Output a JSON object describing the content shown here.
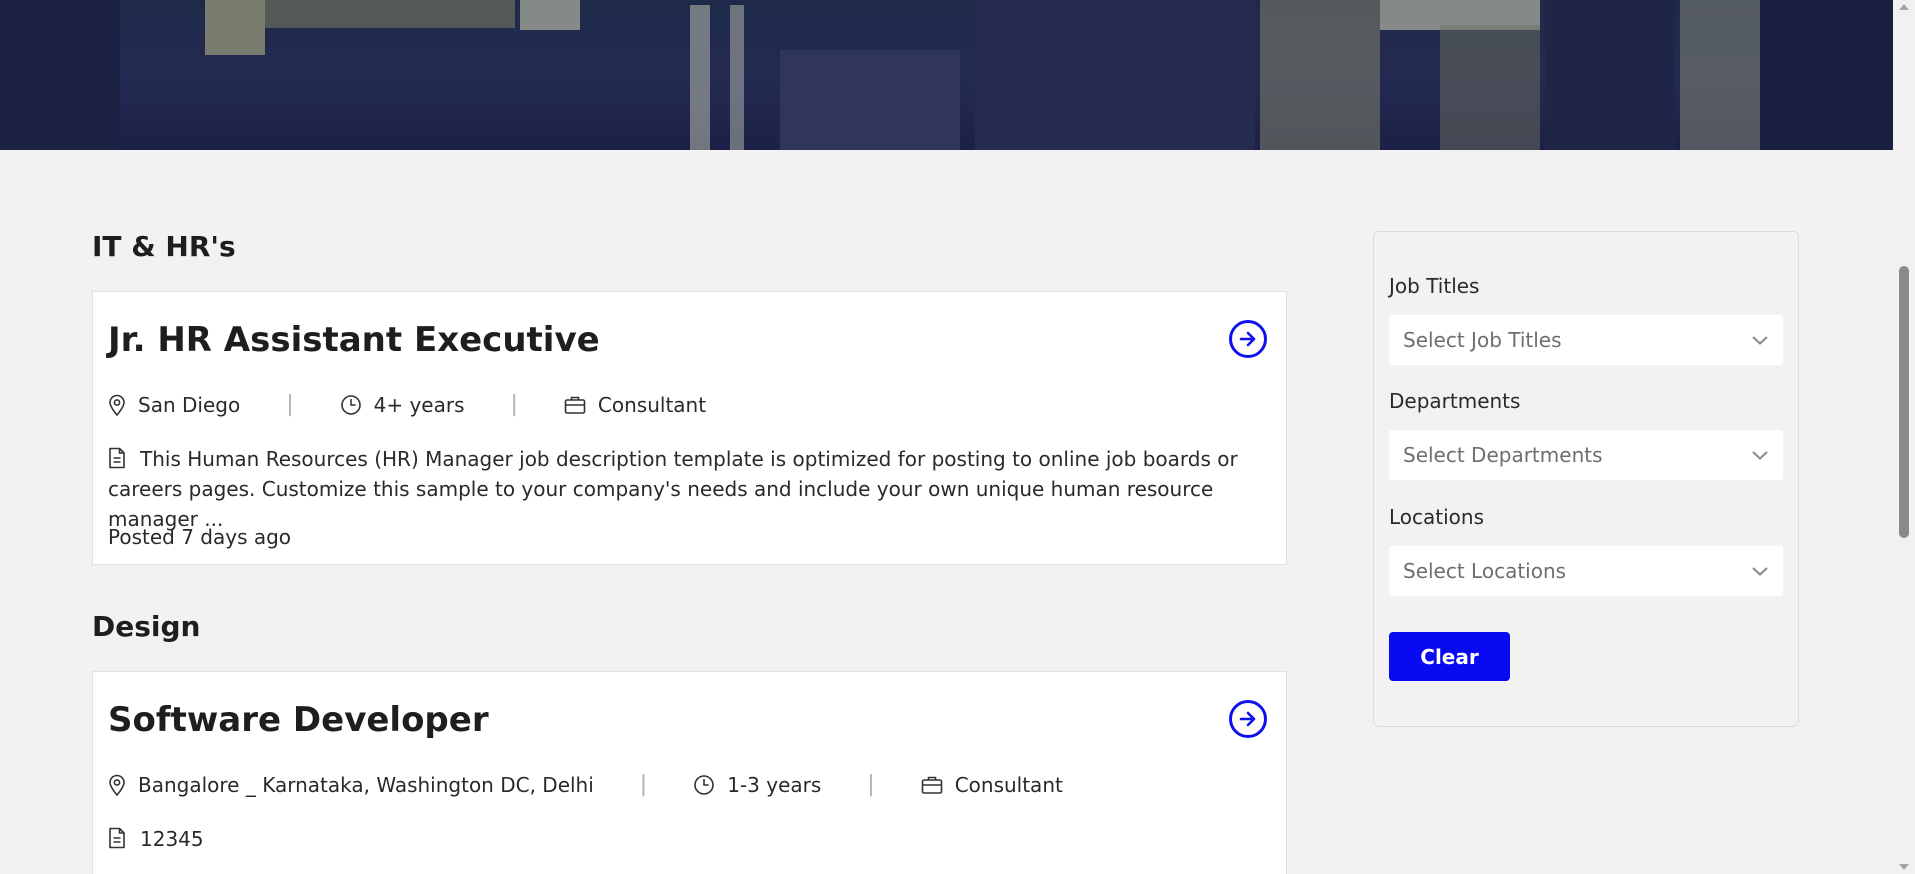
{
  "sections": [
    {
      "title": "IT & HR's",
      "job": {
        "title": "Jr. HR Assistant Executive",
        "location": "San Diego",
        "experience": "4+ years",
        "type": "Consultant",
        "description": "This Human Resources (HR) Manager job description template is optimized for posting to online job boards or careers pages. Customize this sample to your company's needs and include your own unique human resource manager ...",
        "posted": "Posted 7 days ago"
      }
    },
    {
      "title": "Design",
      "job": {
        "title": "Software Developer",
        "location": "Bangalore _ Karnataka, Washington DC, Delhi",
        "experience": "1-3 years",
        "type": "Consultant",
        "description": "12345"
      }
    }
  ],
  "filters": {
    "job_titles": {
      "label": "Job Titles",
      "placeholder": "Select Job Titles"
    },
    "departments": {
      "label": "Departments",
      "placeholder": "Select Departments"
    },
    "locations": {
      "label": "Locations",
      "placeholder": "Select Locations"
    },
    "clear_label": "Clear"
  },
  "colors": {
    "accent": "#0a0af2",
    "page_bg": "#f2f2f2",
    "card_bg": "#ffffff"
  },
  "icons": [
    "location-pin-icon",
    "clock-icon",
    "briefcase-icon",
    "document-icon",
    "arrow-right-circle-icon",
    "chevron-down-icon"
  ]
}
